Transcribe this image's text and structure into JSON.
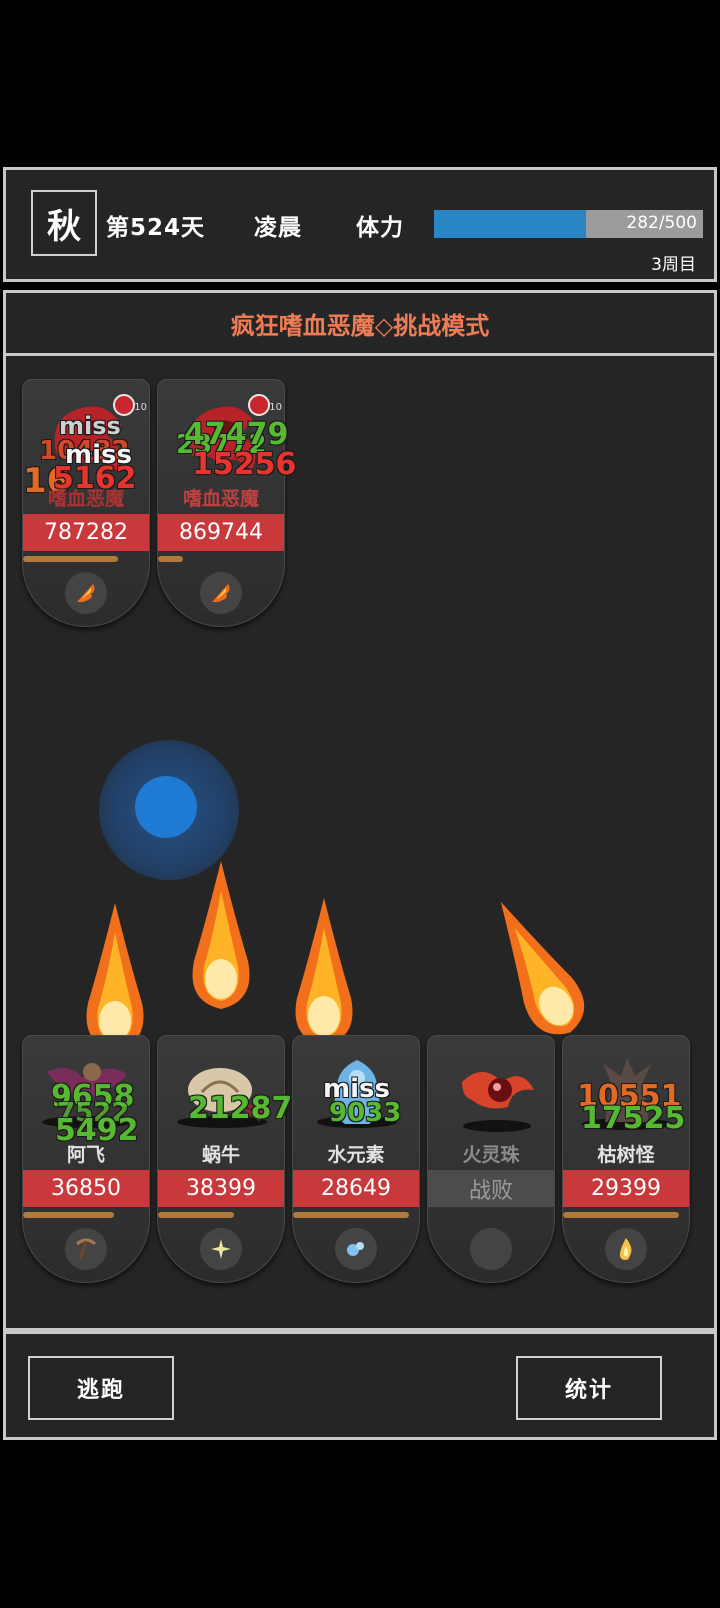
{
  "status": {
    "season": "秋",
    "day": "第524天",
    "time_of_day": "凌晨",
    "stamina_label": "体力",
    "stamina_text": "282/500",
    "stamina_current": 282,
    "stamina_max": 500,
    "round": "3周目"
  },
  "battle": {
    "title": "疯狂嗜血恶魔◇挑战模式",
    "enemies": [
      {
        "name": "嗜血恶魔",
        "hp": "787282",
        "badge_count": "10",
        "mp_fraction": 0.75,
        "floating": [
          "miss",
          "10482",
          "miss",
          "5162",
          "16"
        ]
      },
      {
        "name": "嗜血恶魔",
        "hp": "869744",
        "badge_count": "10",
        "mp_fraction": 0.2,
        "floating": [
          "47479",
          "23772",
          "15256"
        ]
      }
    ],
    "allies": [
      {
        "name": "阿飞",
        "hp": "36850",
        "mp_fraction": 0.72,
        "skill_icon": "pickaxe-icon",
        "floating": [
          "9658",
          "7522",
          "5492"
        ]
      },
      {
        "name": "蜗牛",
        "hp": "38399",
        "mp_fraction": 0.6,
        "skill_icon": "sparkle-icon",
        "floating": [
          "21287"
        ]
      },
      {
        "name": "水元素",
        "hp": "28649",
        "mp_fraction": 0.92,
        "skill_icon": "water-icon",
        "floating": [
          "miss",
          "9033"
        ]
      },
      {
        "name": "火灵珠",
        "hp": "战败",
        "mp_fraction": 0,
        "skill_icon": "empty-icon",
        "floating": []
      },
      {
        "name": "枯树怪",
        "hp": "29399",
        "mp_fraction": 0.92,
        "skill_icon": "flame-icon",
        "floating": [
          "10551",
          "17525"
        ]
      }
    ]
  },
  "buttons": {
    "flee": "逃跑",
    "stats": "统计"
  },
  "colors": {
    "accent_title": "#f07c56",
    "hp_red": "#c9393b",
    "stamina_blue": "#2b86c6",
    "mp_orange": "#b07a3e"
  }
}
